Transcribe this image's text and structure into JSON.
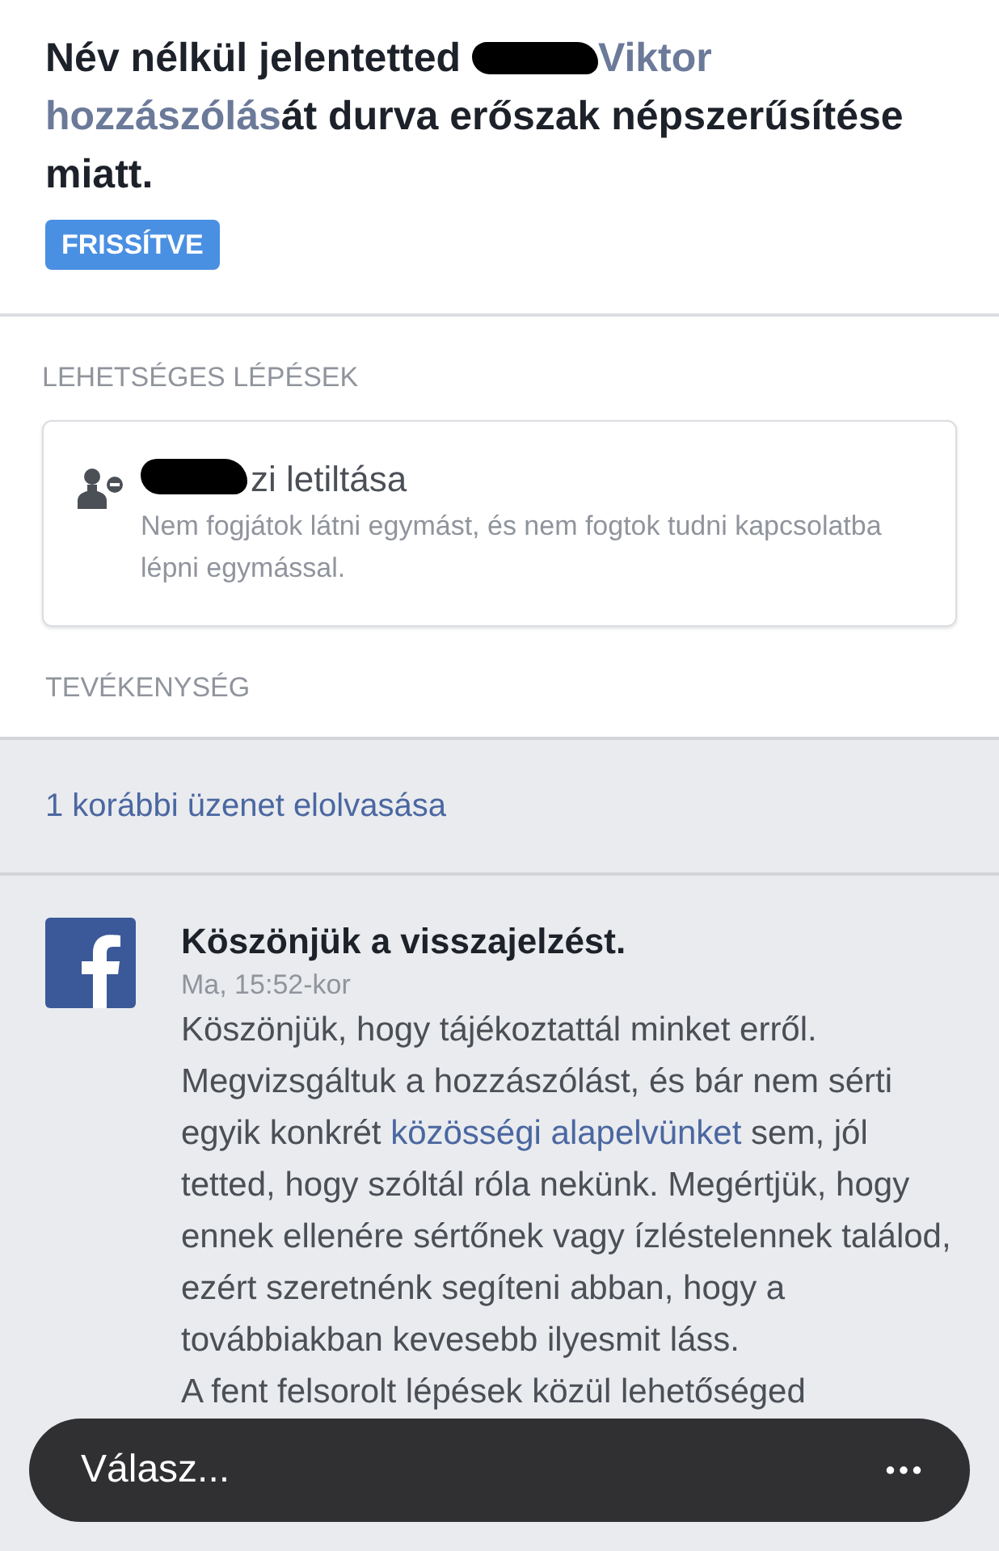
{
  "report": {
    "heading_parts": [
      {
        "kind": "text",
        "text": "Név nélkül jelentetted "
      },
      {
        "kind": "redaction"
      },
      {
        "kind": "link",
        "text": "Viktor"
      },
      {
        "kind": "space"
      },
      {
        "kind": "link",
        "text": "hozzászólás"
      },
      {
        "kind": "text",
        "text": "át durva erőszak népszerűsítése miatt."
      }
    ],
    "badge": "FRISSÍTVE"
  },
  "actions": {
    "label": "LEHETSÉGES LÉPÉSEK",
    "items": [
      {
        "kind": "block",
        "redacted": true,
        "title": "zi letiltása",
        "description": "Nem fogjátok látni egymást, és nem fogtok tudni kapcsolatba lépni egymással."
      }
    ]
  },
  "activity": {
    "label": "TEVÉKENYSÉG",
    "earlier_link": "1 korábbi üzenet elolvasása",
    "message": {
      "title": "Köszönjük a visszajelzést.",
      "time": "Ma, 15:52-kor",
      "paragraphs": [
        [
          {
            "kind": "text",
            "text": "Köszönjük, hogy tájékoztattál minket erről. Megvizsgáltuk a hozzászólást, és bár nem sérti egyik konkrét "
          },
          {
            "kind": "link",
            "text": "közösségi alapelvünket"
          },
          {
            "kind": "text",
            "text": " sem, jól tetted, hogy szóltál róla nekünk. Megértjük, hogy ennek ellenére sértőnek vagy ízléstelennek találod, ezért szeretnénk segíteni abban, hogy a továbbiakban kevesebb ilyesmit láss."
          }
        ],
        [
          {
            "kind": "text",
            "text": "A fent felsorolt lépések közül lehetőséged"
          }
        ]
      ]
    }
  },
  "reply": {
    "placeholder": "Válasz..."
  }
}
